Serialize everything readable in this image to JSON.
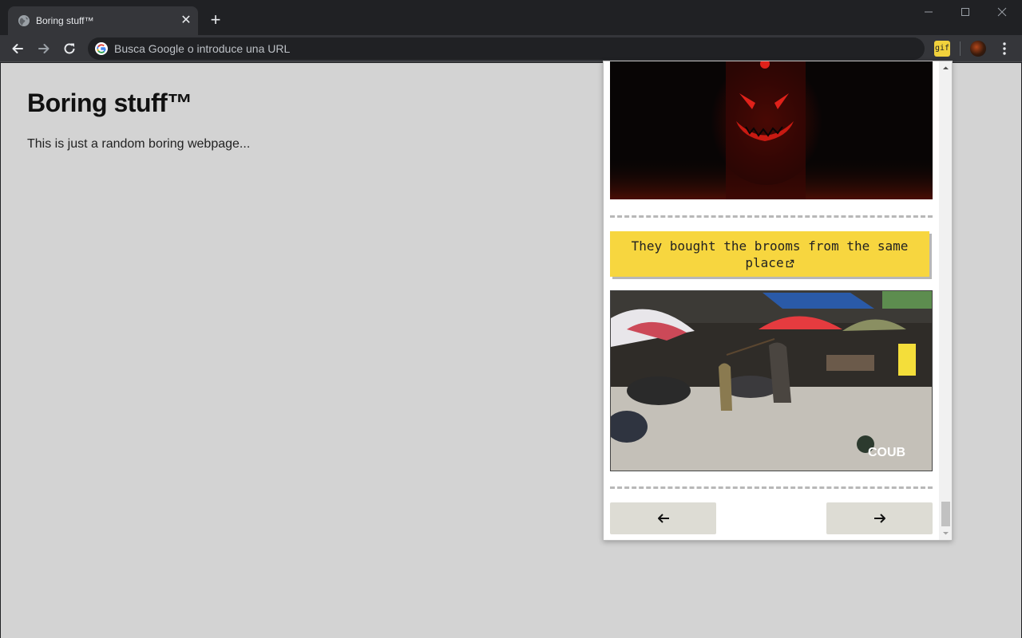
{
  "browser": {
    "tab": {
      "title": "Boring stuff™",
      "close_glyph": "✕"
    },
    "new_tab_glyph": "+",
    "window_controls": {
      "minimize": "—",
      "maximize": "☐",
      "close": "✕"
    },
    "omnibox": {
      "placeholder": "Busca Google o introduce una URL"
    },
    "extension": {
      "label": "gif"
    },
    "icons": [
      "globe-icon",
      "back-arrow-icon",
      "forward-arrow-icon",
      "reload-icon",
      "google-icon",
      "profile-avatar",
      "three-dots-menu-icon"
    ]
  },
  "page": {
    "title": "Boring stuff™",
    "text": "This is just a random boring webpage..."
  },
  "popup": {
    "caption": "They bought the brooms from the same place",
    "watermark": "COUB",
    "prev_label": "←",
    "next_label": "→",
    "accent_color": "#f7d63f"
  }
}
